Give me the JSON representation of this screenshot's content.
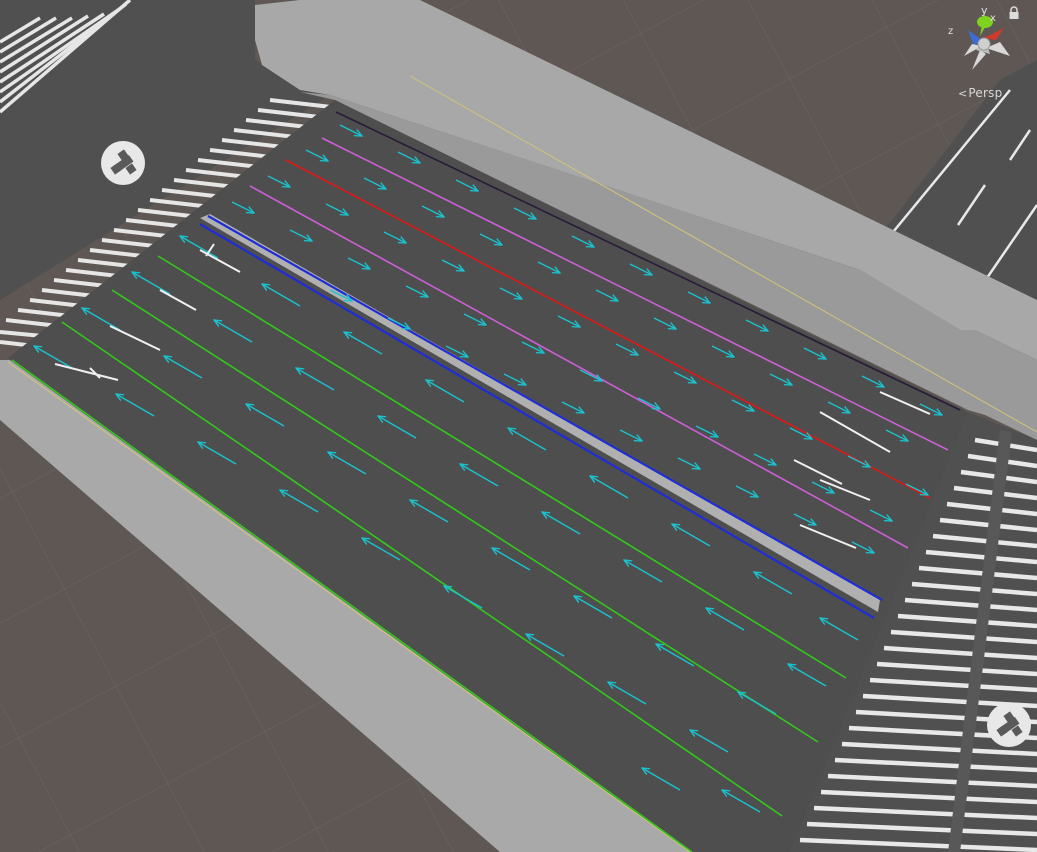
{
  "viewport": {
    "mode_label": "Persp",
    "gizmo_axes": {
      "y": "y",
      "x": "x",
      "z": "z"
    },
    "colors": {
      "ground": "#5f5753",
      "ground_grid": "#6c6561",
      "sidewalk": "#a9a9a9",
      "sidewalk_edge": "#8e8e8e",
      "road": "#505050",
      "crosswalk_stripe": "#e8e8e8",
      "median": "#9c9c9c",
      "flow_arrow": "#19c3cf",
      "lane_magenta": "#cc5fd6",
      "lane_red": "#e01818",
      "lane_blue": "#1f2dd6",
      "lane_green": "#33c81c",
      "gizmo_y": "#7ed321",
      "gizmo_x": "#d33a2e",
      "gizmo_z": "#3b6cd8"
    }
  },
  "icons": {
    "camera_handle": "scene-camera-gizmo-icon",
    "lock": "lock-icon",
    "orientation": "orientation-gizmo-icon"
  }
}
